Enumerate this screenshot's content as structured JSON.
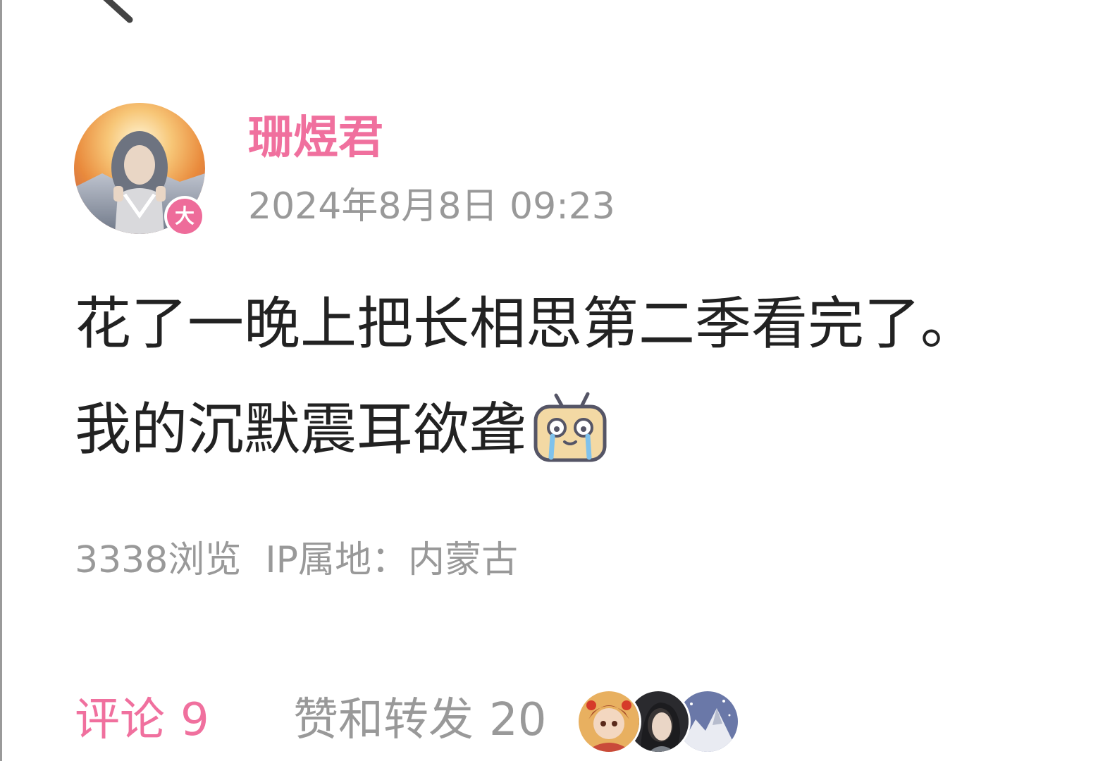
{
  "author": {
    "name": "珊煜君",
    "badge": "大"
  },
  "post": {
    "timestamp": "2024年8月8日 09:23",
    "line1": "花了一晚上把长相思第二季看完了。",
    "line2": "我的沉默震耳欲聋",
    "emoji": "crying-tv-emoji"
  },
  "meta": {
    "views": "3338浏览",
    "ip": "IP属地：内蒙古"
  },
  "tabs": {
    "comments_label": "评论",
    "comments_count": "9",
    "likes_label": "赞和转发",
    "likes_count": "20"
  },
  "colors": {
    "accent_pink": "#f0709e",
    "text_primary": "#222222",
    "text_secondary": "#999999"
  }
}
